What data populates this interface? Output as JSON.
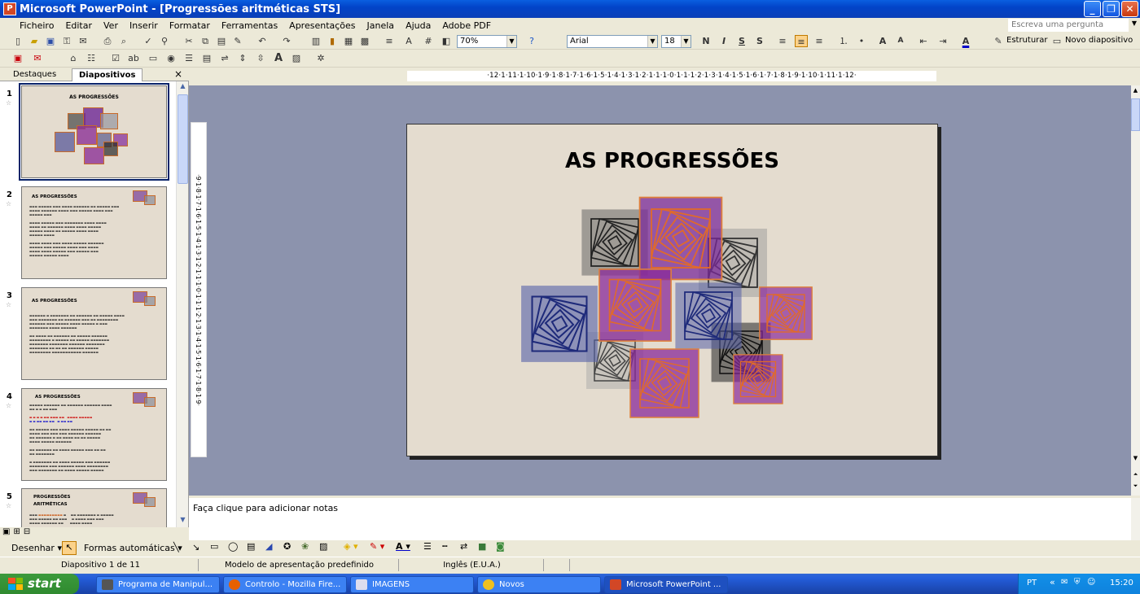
{
  "window": {
    "title": "Microsoft PowerPoint - [Progressões aritméticas STS]",
    "app_icon": "powerpoint-icon"
  },
  "menu": {
    "items": [
      "Ficheiro",
      "Editar",
      "Ver",
      "Inserir",
      "Formatar",
      "Ferramentas",
      "Apresentações",
      "Janela",
      "Ajuda",
      "Adobe PDF"
    ],
    "ask_placeholder": "Escreva uma pergunta"
  },
  "toolbar": {
    "zoom": "70%",
    "font": "Arial",
    "font_size": "18",
    "bold": "N",
    "italic": "I",
    "underline": "S",
    "shadow": "S",
    "structure_label": "Estruturar",
    "new_slide_label": "Novo diapositivo"
  },
  "pane": {
    "tab_outline": "Destaques",
    "tab_slides": "Diapositivos",
    "close": "×",
    "slides": [
      {
        "num": "1",
        "title": "AS PROGRESSÕES"
      },
      {
        "num": "2",
        "title": "AS PROGRESSÕES"
      },
      {
        "num": "3",
        "title": "AS PROGRESSÕES"
      },
      {
        "num": "4",
        "title": "AS PROGRESSÕES"
      },
      {
        "num": "5",
        "title": "PROGRESSÕES ARITMÉTICAS"
      }
    ]
  },
  "ruler": {
    "horizontal": "·12·1·11·1·10·1·9·1·8·1·7·1·6·1·5·1·4·1·3·1·2·1·1·1·0·1·1·1·2·1·3·1·4·1·5·1·6·1·7·1·8·1·9·1·10·1·11·1·12·",
    "vertical": "·9·1·8·1·7·1·6·1·5·1·4·1·3·1·2·1·1·1·0·1·1·1·2·1·3·1·4·1·5·1·6·1·7·1·8·1·9·"
  },
  "slide": {
    "title": "AS PROGRESSÕES"
  },
  "notes": {
    "placeholder": "Faça clique para adicionar notas"
  },
  "drawing": {
    "draw_label": "Desenhar",
    "autoshapes_label": "Formas automáticas"
  },
  "status": {
    "slide_count": "Diapositivo 1 de 11",
    "template": "Modelo de apresentação predefinido",
    "language": "Inglês (E.U.A.)"
  },
  "taskbar": {
    "start": "start",
    "tasks": [
      "Programa de Manipul...",
      "Controlo - Mozilla Fire...",
      "IMAGENS",
      "Novos",
      "Microsoft PowerPoint ..."
    ],
    "lang": "PT",
    "clock": "15:20"
  },
  "colors": {
    "titlebar": "#0a46d8",
    "slide_bg": "#e4dccf",
    "workspace": "#8c93ad",
    "taskbar": "#245edb",
    "start": "#3c9a3c"
  }
}
